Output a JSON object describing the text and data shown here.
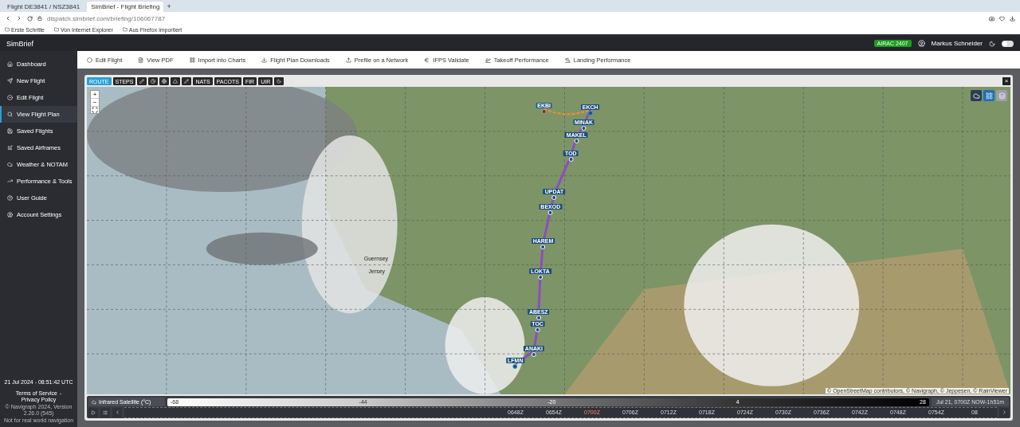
{
  "browser": {
    "tabs": [
      {
        "label": "Flight DE3841 / NSZ3841",
        "selected": false
      },
      {
        "label": "SimBrief - Flight Briefing",
        "selected": true
      }
    ],
    "new_tab": "+",
    "address": "dispatch.simbrief.com/briefing/106067787",
    "bookmarks": [
      "Erste Schritte",
      "Von Internet Explorer",
      "Aus Firefox importiert"
    ]
  },
  "header": {
    "brand": "SimBrief",
    "airac": "AIRAC 2407",
    "user": "Markus Schneider",
    "dark_mode": false
  },
  "sidebar": {
    "items": [
      {
        "label": "Dashboard",
        "selected": false
      },
      {
        "label": "New Flight",
        "selected": false
      },
      {
        "label": "Edit Flight",
        "selected": false
      },
      {
        "label": "View Flight Plan",
        "selected": true
      },
      {
        "label": "Saved Flights",
        "selected": false
      },
      {
        "label": "Saved Airframes",
        "selected": false
      },
      {
        "label": "Weather & NOTAM",
        "selected": false
      },
      {
        "label": "Performance & Tools",
        "selected": false
      },
      {
        "label": "User Guide",
        "selected": false
      },
      {
        "label": "Account Settings",
        "selected": false
      }
    ],
    "clock": "21 Jul 2024 - 08:51:42 UTC",
    "links": [
      "Terms of Service",
      "Privacy Policy"
    ],
    "separator": "-",
    "copyright": "© Navigraph 2024, Version 2.26.0 (545)",
    "disclaimer": "Not for real world navigation"
  },
  "toolbar": [
    "Edit Flight",
    "View PDF",
    "Import into Charts",
    "Flight Plan Downloads",
    "Prefile on a Network",
    "IFPS Validate",
    "Takeoff Performance",
    "Landing Performance"
  ],
  "map": {
    "layers": [
      {
        "kind": "text",
        "label": "ROUTE",
        "selected": true
      },
      {
        "kind": "text",
        "label": "STEPS",
        "selected": false
      },
      {
        "kind": "icon",
        "selected": false
      },
      {
        "kind": "icon",
        "selected": false
      },
      {
        "kind": "icon",
        "selected": false
      },
      {
        "kind": "icon",
        "selected": false
      },
      {
        "kind": "icon",
        "selected": false
      },
      {
        "kind": "text",
        "label": "NATS",
        "selected": false
      },
      {
        "kind": "text",
        "label": "PACOTS",
        "selected": false
      },
      {
        "kind": "text",
        "label": "FIR",
        "selected": false
      },
      {
        "kind": "text",
        "label": "UIR",
        "selected": false
      },
      {
        "kind": "icon",
        "selected": false
      }
    ],
    "zoom_in": "+",
    "zoom_out": "−",
    "close": "×",
    "waypoints": [
      {
        "name": "EKBI",
        "kind": "alternate"
      },
      {
        "name": "EKCH",
        "kind": "airport"
      },
      {
        "name": "MINAK",
        "kind": "fix"
      },
      {
        "name": "MAKEL",
        "kind": "fix"
      },
      {
        "name": "TOD",
        "kind": "fix"
      },
      {
        "name": "UPDAT",
        "kind": "fix"
      },
      {
        "name": "BEXOD",
        "kind": "fix"
      },
      {
        "name": "HAREM",
        "kind": "fix"
      },
      {
        "name": "LOKTA",
        "kind": "fix"
      },
      {
        "name": "ABESZ",
        "kind": "fix"
      },
      {
        "name": "TOC",
        "kind": "fix"
      },
      {
        "name": "ANAKI",
        "kind": "fix"
      },
      {
        "name": "LFMN",
        "kind": "airport"
      }
    ],
    "places": [
      "Guernsey",
      "Jersey"
    ],
    "attribution": "© OpenStreetMap contributors, © Navigraph, © Jeppesen, © RainViewer",
    "weather_layer": "Infrared Satellite (°C)",
    "scale": [
      "-68",
      "-44",
      "-20",
      "4",
      "28"
    ],
    "time": "Jul 21, 0700Z NOW-1h51m",
    "ticks": [
      {
        "label": "0648Z",
        "selected": false
      },
      {
        "label": "0654Z",
        "selected": false
      },
      {
        "label": "0700Z",
        "selected": true
      },
      {
        "label": "0706Z",
        "selected": false
      },
      {
        "label": "0712Z",
        "selected": false
      },
      {
        "label": "0718Z",
        "selected": false
      },
      {
        "label": "0724Z",
        "selected": false
      },
      {
        "label": "0730Z",
        "selected": false
      },
      {
        "label": "0736Z",
        "selected": false
      },
      {
        "label": "0742Z",
        "selected": false
      },
      {
        "label": "0748Z",
        "selected": false
      },
      {
        "label": "0754Z",
        "selected": false
      },
      {
        "label": "08",
        "selected": false
      }
    ]
  }
}
